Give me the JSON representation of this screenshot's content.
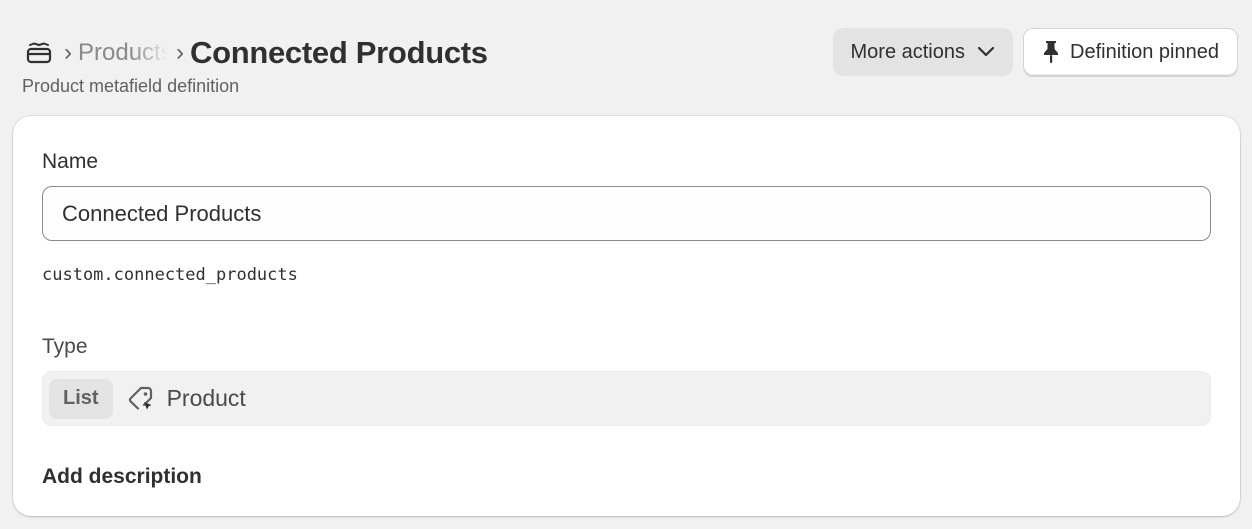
{
  "header": {
    "breadcrumb": {
      "home_icon": "store-icon",
      "parent_label": "Products",
      "separator": "›"
    },
    "title": "Connected Products",
    "subtitle": "Product metafield definition",
    "actions": {
      "more_actions_label": "More actions",
      "more_actions_icon": "chevron-down-icon",
      "pin_label": "Definition pinned",
      "pin_icon": "pin-icon"
    }
  },
  "form": {
    "name": {
      "label": "Name",
      "value": "Connected Products"
    },
    "namespace_key": "custom.connected_products",
    "type": {
      "label": "Type",
      "list_badge": "List",
      "icon": "product-tag-icon",
      "value": "Product"
    },
    "add_description_label": "Add description"
  },
  "colors": {
    "background": "#f1f1f1",
    "card": "#ffffff",
    "text": "#303030",
    "muted_text": "#616161",
    "secondary_button": "#e3e3e3"
  }
}
